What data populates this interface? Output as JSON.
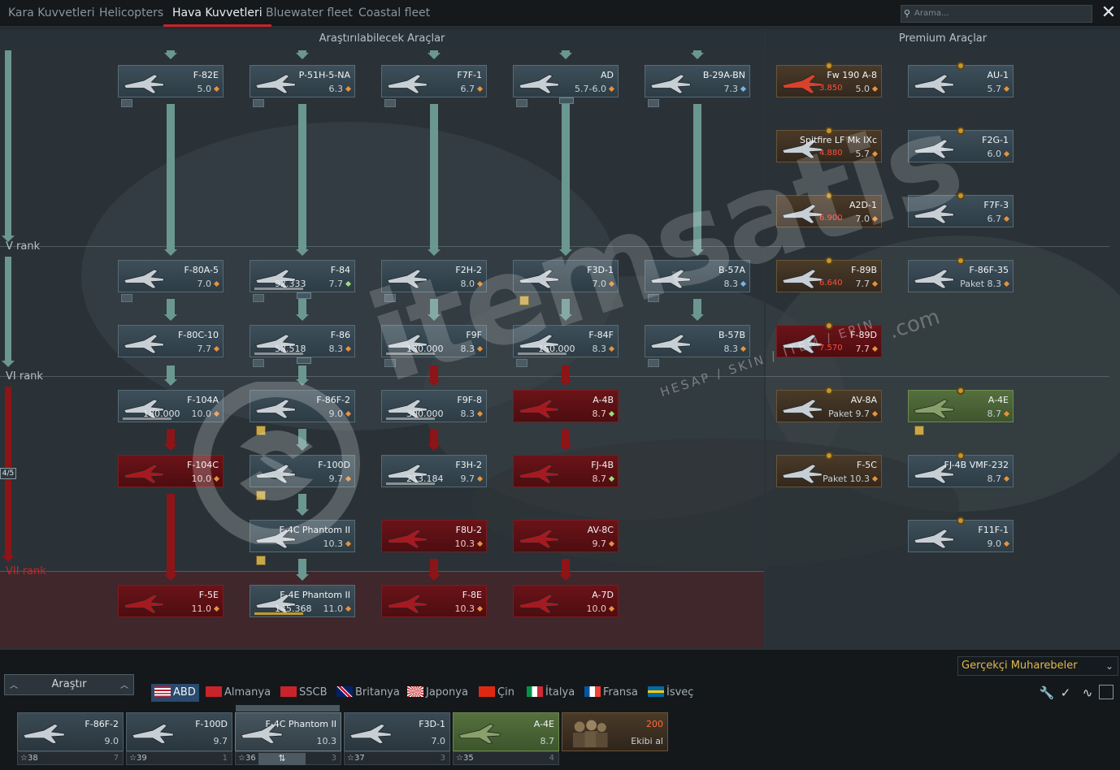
{
  "top_tabs": [
    {
      "label": "Kara Kuvvetleri"
    },
    {
      "label": "Helicopters"
    },
    {
      "label": "Hava Kuvvetleri",
      "active": true
    },
    {
      "label": "Bluewater fleet"
    },
    {
      "label": "Coastal fleet"
    }
  ],
  "search": {
    "placeholder": "Arama..."
  },
  "sections": {
    "research": "Araştırılabilecek Araçlar",
    "premium": "Premium Araçlar"
  },
  "ranks": {
    "v": "V rank",
    "vi": "VI rank",
    "vii": "VII rank",
    "progress": "4/5"
  },
  "tree": {
    "r0": [
      {
        "name": "F-82E",
        "br": "5.0"
      },
      {
        "name": "P-51H-5-NA",
        "br": "6.3"
      },
      {
        "name": "F7F-1",
        "br": "6.7"
      },
      {
        "name": "AD",
        "br": "5.7-6.0"
      },
      {
        "name": "B-29A-BN",
        "br": "7.3"
      }
    ],
    "r1": [
      {
        "name": "F-80A-5",
        "br": "7.0"
      },
      {
        "name": "F-84",
        "br": "7.7",
        "rp": "92.333"
      },
      {
        "name": "F2H-2",
        "br": "8.0"
      },
      {
        "name": "F3D-1",
        "br": "7.0"
      },
      {
        "name": "B-57A",
        "br": "8.3"
      }
    ],
    "r2": [
      {
        "name": "F-80C-10",
        "br": "7.7"
      },
      {
        "name": "F-86",
        "br": "8.3",
        "rp": "53.518"
      },
      {
        "name": "F9F",
        "br": "8.3",
        "rp": "130.000"
      },
      {
        "name": "F-84F",
        "br": "8.3",
        "rp": "150.000"
      },
      {
        "name": "B-57B",
        "br": "8.3"
      }
    ],
    "r3": [
      {
        "name": "F-104A",
        "br": "10.0",
        "rp": "180.000"
      },
      {
        "name": "F-86F-2",
        "br": "9.0"
      },
      {
        "name": "F9F-8",
        "br": "8.3",
        "rp": "300.000"
      },
      {
        "name": "A-4B",
        "br": "8.7"
      }
    ],
    "r4": [
      {
        "name": "F-104C",
        "br": "10.0"
      },
      {
        "name": "F-100D",
        "br": "9.7"
      },
      {
        "name": "F3H-2",
        "br": "9.7",
        "rp": "213.184"
      },
      {
        "name": "FJ-4B",
        "br": "8.7"
      }
    ],
    "r5": [
      {
        "name": "F-4C Phantom II",
        "br": "10.3"
      },
      {
        "name": "F8U-2",
        "br": "10.3"
      },
      {
        "name": "AV-8C",
        "br": "9.7"
      }
    ],
    "r6": [
      {
        "name": "F-5E",
        "br": "11.0"
      },
      {
        "name": "F-4E Phantom II",
        "br": "11.0",
        "rp": "145.368"
      },
      {
        "name": "F-8E",
        "br": "10.3"
      },
      {
        "name": "A-7D",
        "br": "10.0"
      }
    ]
  },
  "premium": [
    {
      "name": "Fw 190 A-8",
      "br": "5.0",
      "price": "3.850"
    },
    {
      "name": "AU-1",
      "br": "5.7"
    },
    {
      "name": "Spitfire LF Mk IXc",
      "br": "5.7",
      "price": "4.880"
    },
    {
      "name": "F2G-1",
      "br": "6.0"
    },
    {
      "name": "A2D-1",
      "br": "7.0",
      "price": "6.900"
    },
    {
      "name": "F7F-3",
      "br": "6.7"
    },
    {
      "name": "F-89B",
      "br": "7.7",
      "price": "6.640"
    },
    {
      "name": "F-86F-35",
      "br": "Paket 8.3"
    },
    {
      "name": "F-89D",
      "br": "7.7",
      "price": "7.570"
    },
    {
      "name": "AV-8A",
      "br": "Paket 9.7"
    },
    {
      "name": "A-4E",
      "br": "8.7"
    },
    {
      "name": "F-5C",
      "br": "Paket 10.3"
    },
    {
      "name": "FJ-4B VMF-232",
      "br": "8.7"
    },
    {
      "name": "F11F-1",
      "br": "9.0"
    }
  ],
  "bottom": {
    "research_btn": "Araştır",
    "battle_mode": "Gerçekçi Muharebeler",
    "nations": [
      {
        "label": "ABD",
        "active": true
      },
      {
        "label": "Almanya"
      },
      {
        "label": "SSCB"
      },
      {
        "label": "Britanya"
      },
      {
        "label": "Japonya"
      },
      {
        "label": "Çin"
      },
      {
        "label": "İtalya"
      },
      {
        "label": "Fransa"
      },
      {
        "label": "İsveç"
      }
    ],
    "crew": [
      {
        "name": "F-86F-2",
        "br": "9.0",
        "num": "38",
        "cnt": "7"
      },
      {
        "name": "F-100D",
        "br": "9.7",
        "num": "39",
        "cnt": "1"
      },
      {
        "name": "F-4C Phantom II",
        "br": "10.3",
        "num": "36",
        "cnt": "3"
      },
      {
        "name": "F3D-1",
        "br": "7.0",
        "num": "37",
        "cnt": "3"
      },
      {
        "name": "A-4E",
        "br": "8.7",
        "num": "35",
        "cnt": "4"
      }
    ],
    "crew_buy": {
      "price": "200",
      "label": "Ekibi al"
    }
  },
  "watermark": {
    "text": "itemsatis",
    "sub": "HESAP / SKIN / ITEM / EPIN",
    "domain": ".com"
  },
  "colors": {
    "accent": "#c8242a",
    "research_line": "#6b9791",
    "locked": "#8d1417",
    "gold": "#e4b94a"
  }
}
